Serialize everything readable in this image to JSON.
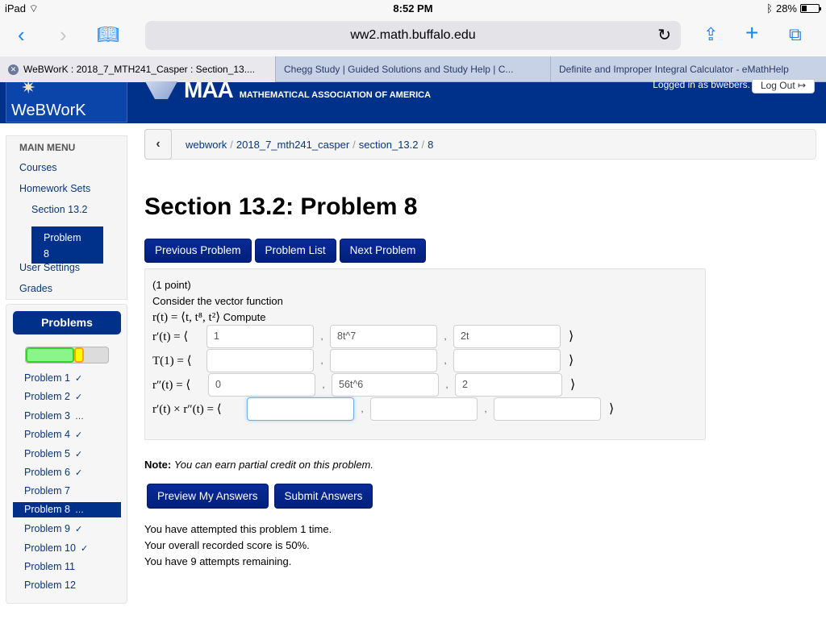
{
  "statusbar": {
    "device": "iPad",
    "time": "8:52 PM",
    "battery": "28%",
    "battery_level": 0.28
  },
  "browser": {
    "url": "ww2.math.buffalo.edu",
    "icons": [
      "back-icon",
      "forward-icon",
      "bookmarks-icon",
      "reload-icon",
      "share-icon",
      "new-tab-icon",
      "tabs-icon"
    ],
    "tabs": [
      {
        "label": "WeBWorK : 2018_7_MTH241_Casper : Section_13....",
        "active": true
      },
      {
        "label": "Chegg Study | Guided Solutions and Study Help | C...",
        "active": false
      },
      {
        "label": "Definite and Improper Integral Calculator - eMathHelp",
        "active": false
      }
    ]
  },
  "masthead": {
    "logo_text": "WeBWorK",
    "maa_big": "MAA",
    "maa_small": "MATHEMATICAL ASSOCIATION OF AMERICA",
    "logged_in": "Logged in as bwebers.",
    "logout_label": "Log Out ↦"
  },
  "main_menu": {
    "title": "MAIN MENU",
    "courses": "Courses",
    "homework_sets": "Homework Sets",
    "section": "Section 13.2",
    "problem_line1": "Problem",
    "problem_line2": "8",
    "user_settings": "User Settings",
    "grades": "Grades"
  },
  "problems_panel": {
    "header": "Problems",
    "progress": {
      "correct_fraction": 0.58,
      "partial_fraction": 0.11
    },
    "items": [
      {
        "label": "Problem 1",
        "status": "✓"
      },
      {
        "label": "Problem 2",
        "status": "✓"
      },
      {
        "label": "Problem 3",
        "status": "…"
      },
      {
        "label": "Problem 4",
        "status": "✓"
      },
      {
        "label": "Problem 5",
        "status": "✓"
      },
      {
        "label": "Problem 6",
        "status": "✓"
      },
      {
        "label": "Problem 7",
        "status": ""
      },
      {
        "label": "Problem 8",
        "status": "…",
        "active": true
      },
      {
        "label": "Problem 9",
        "status": "✓"
      },
      {
        "label": "Problem 10",
        "status": "✓"
      },
      {
        "label": "Problem 11",
        "status": ""
      },
      {
        "label": "Problem 12",
        "status": ""
      }
    ]
  },
  "breadcrumb": {
    "back": "‹",
    "parts": [
      "webwork",
      "2018_7_mth241_casper",
      "section_13.2",
      "8"
    ]
  },
  "page_title": "Section 13.2: Problem 8",
  "nav_buttons": {
    "previous": "Previous Problem",
    "list": "Problem List",
    "next": "Next Problem"
  },
  "problem": {
    "points": "(1 point)",
    "intro": "Consider the vector function",
    "function_text": "r(t) = ⟨t, t⁸, t²⟩",
    "compute": "Compute",
    "rows": [
      {
        "label": "r′(t) = ⟨",
        "values": [
          "1",
          "8t^7",
          "2t"
        ]
      },
      {
        "label": "T(1) = ⟨",
        "values": [
          "",
          "",
          ""
        ]
      },
      {
        "label": "r″(t) = ⟨",
        "values": [
          "0",
          "56t^6",
          "2"
        ]
      },
      {
        "label": "r′(t) × r″(t) = ⟨",
        "values": [
          "",
          "",
          ""
        ]
      }
    ],
    "comma": ",",
    "close": "⟩"
  },
  "note": {
    "label": "Note:",
    "text": "You can earn partial credit on this problem."
  },
  "submit_buttons": {
    "preview": "Preview My Answers",
    "submit": "Submit Answers"
  },
  "attempts": {
    "line1": "You have attempted this problem 1 time.",
    "line2": "Your overall recorded score is 50%.",
    "line3": "You have 9 attempts remaining."
  }
}
